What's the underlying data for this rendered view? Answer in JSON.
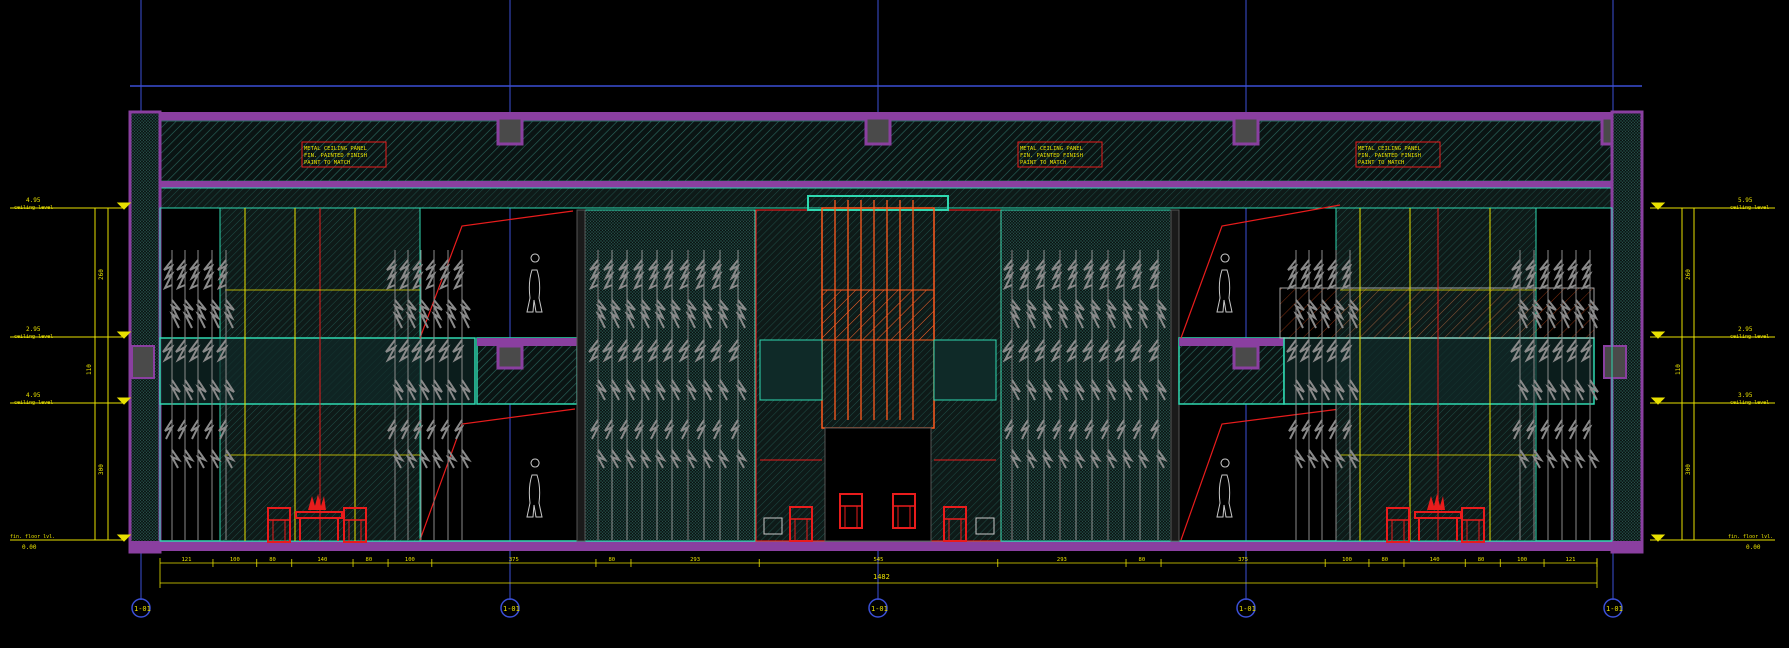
{
  "drawing": {
    "colors": {
      "background": "#000000",
      "grid_line": "#3b4fd6",
      "structure": "#8a3fa0",
      "hatch": "#2c6a62",
      "cyan_outline": "#2fd8b0",
      "red": "#e81c1c",
      "orange": "#ff5a1e",
      "yellow": "#e8e000",
      "trees": "#8a8a8a",
      "white_line": "#c8c8c8"
    },
    "grid_bubbles": [
      "1-01",
      "1-01",
      "1-01",
      "1-01",
      "1-01"
    ],
    "overall_dimension": "1482",
    "bottom_dimensions": [
      "121",
      "100",
      "80",
      "140",
      "80",
      "100",
      "375",
      "80",
      "293",
      "545",
      "293",
      "80",
      "375",
      "100",
      "80",
      "140",
      "80",
      "100",
      "121"
    ],
    "level_left": [
      {
        "value": "4.95",
        "label": "ceiling level"
      },
      {
        "value": "2.95",
        "label": "ceiling level"
      },
      {
        "value": "4.95",
        "label": "ceiling level"
      },
      {
        "value": "0.00",
        "label": "fin. floor lvl."
      }
    ],
    "level_right": [
      {
        "value": "5.95",
        "label": "ceiling level"
      },
      {
        "value": "2.95",
        "label": "ceiling level"
      },
      {
        "value": "3.95",
        "label": "ceiling level"
      },
      {
        "value": "0.00",
        "label": "fin. floor lvl."
      }
    ],
    "vertical_dims_left": [
      "260",
      "110",
      "300"
    ],
    "vertical_dims_right": [
      "260",
      "110",
      "300"
    ],
    "note_lines": [
      "METAL CEILING PANEL",
      "FIN. PAINTED FINISH",
      "PAINT TO MATCH"
    ]
  }
}
